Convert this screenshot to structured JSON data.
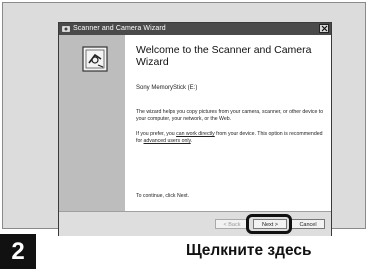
{
  "window": {
    "title": "Scanner and Camera Wizard"
  },
  "wizard": {
    "heading": "Welcome to the Scanner and Camera Wizard",
    "device": "Sony MemoryStick (E:)",
    "para1": "The wizard helps you copy pictures from your camera, scanner, or other device to your computer, your network, or the Web.",
    "para2_pre": "If you prefer, you ",
    "para2_link1": "can work directly",
    "para2_mid": " from your device. This option is recommended for ",
    "para2_link2": "advanced users only",
    "para2_end": ".",
    "hint": "To continue, click Next."
  },
  "buttons": {
    "back": "< Back",
    "next": "Next >",
    "cancel": "Cancel"
  },
  "step": {
    "number": "2",
    "caption": "Щелкните здесь"
  },
  "colors": {
    "titlebar": "#4a4a4a",
    "sidebar": "#bdbdbd",
    "highlight": "#111111"
  }
}
